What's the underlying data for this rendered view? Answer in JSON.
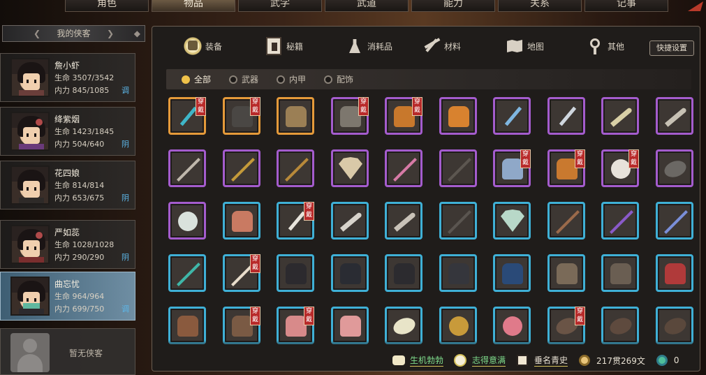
{
  "top_tabs": [
    {
      "label": "角色",
      "active": false
    },
    {
      "label": "物品",
      "active": true
    },
    {
      "label": "武学",
      "active": false
    },
    {
      "label": "武道",
      "active": false
    },
    {
      "label": "能力",
      "active": false
    },
    {
      "label": "关系",
      "active": false
    },
    {
      "label": "记事",
      "active": false
    }
  ],
  "left": {
    "header": "我的侠客",
    "companions": [
      {
        "name": "詹小虾",
        "hp_label": "生命",
        "hp": "3507/3542",
        "mp_label": "内力",
        "mp": "845/1085",
        "tag": "调",
        "selected": false
      },
      {
        "name": "绛紫烟",
        "hp_label": "生命",
        "hp": "1423/1845",
        "mp_label": "内力",
        "mp": "504/640",
        "tag": "阴",
        "selected": false
      },
      {
        "name": "花四娘",
        "hp_label": "生命",
        "hp": "814/814",
        "mp_label": "内力",
        "mp": "653/675",
        "tag": "阴",
        "selected": false
      },
      {
        "name": "严如蕊",
        "hp_label": "生命",
        "hp": "1028/1028",
        "mp_label": "内力",
        "mp": "290/290",
        "tag": "阴",
        "selected": false
      },
      {
        "name": "曲忘忧",
        "hp_label": "生命",
        "hp": "964/964",
        "mp_label": "内力",
        "mp": "699/750",
        "tag": "调",
        "selected": true
      }
    ],
    "empty_label": "暂无侠客"
  },
  "categories": [
    {
      "label": "装备",
      "icon": "equipment-icon",
      "active": true
    },
    {
      "label": "秘籍",
      "icon": "book-icon",
      "active": false
    },
    {
      "label": "消耗品",
      "icon": "flask-icon",
      "active": false
    },
    {
      "label": "材料",
      "icon": "material-icon",
      "active": false
    },
    {
      "label": "地图",
      "icon": "map-icon",
      "active": false
    },
    {
      "label": "其他",
      "icon": "other-icon",
      "active": false
    }
  ],
  "shortcut_button": "快捷设置",
  "filters": [
    {
      "label": "全部",
      "active": true
    },
    {
      "label": "武器",
      "active": false
    },
    {
      "label": "内甲",
      "active": false
    },
    {
      "label": "配饰",
      "active": false
    }
  ],
  "wear_tag": "穿戴",
  "items": [
    [
      {
        "rarity": "orange",
        "kind": "sword",
        "color": "#3fb6c8",
        "worn": true
      },
      {
        "rarity": "orange",
        "kind": "armor",
        "color": "#4a4744",
        "worn": true
      },
      {
        "rarity": "orange",
        "kind": "armor",
        "color": "#9b7f55",
        "worn": false
      },
      {
        "rarity": "purple",
        "kind": "armor",
        "color": "#7d776e",
        "worn": true
      },
      {
        "rarity": "purple",
        "kind": "armor",
        "color": "#c8782c",
        "worn": true
      },
      {
        "rarity": "purple",
        "kind": "armor",
        "color": "#d8822f",
        "worn": false
      },
      {
        "rarity": "purple",
        "kind": "sword",
        "color": "#7fb6e0",
        "worn": false
      },
      {
        "rarity": "purple",
        "kind": "sword",
        "color": "#cfd6de",
        "worn": false
      },
      {
        "rarity": "purple",
        "kind": "blade",
        "color": "#d8cfa6",
        "worn": false
      },
      {
        "rarity": "purple",
        "kind": "blade",
        "color": "#c7c1b4",
        "worn": false
      }
    ],
    [
      {
        "rarity": "purple",
        "kind": "staff",
        "color": "#bfb8ac",
        "worn": false
      },
      {
        "rarity": "purple",
        "kind": "staff",
        "color": "#c49a3a",
        "worn": false
      },
      {
        "rarity": "purple",
        "kind": "staff",
        "color": "#b8893a",
        "worn": false
      },
      {
        "rarity": "purple",
        "kind": "fan",
        "color": "#d9c9a8",
        "worn": false
      },
      {
        "rarity": "purple",
        "kind": "staff",
        "color": "#d67aa6",
        "worn": false
      },
      {
        "rarity": "purple",
        "kind": "staff",
        "color": "#5c5650",
        "worn": false
      },
      {
        "rarity": "purple",
        "kind": "armor",
        "color": "#8fa8c8",
        "worn": true
      },
      {
        "rarity": "purple",
        "kind": "armor",
        "color": "#c9792f",
        "worn": true
      },
      {
        "rarity": "purple",
        "kind": "round",
        "color": "#e7e2da",
        "worn": true
      },
      {
        "rarity": "purple",
        "kind": "leaf",
        "color": "#6b6864",
        "worn": false
      }
    ],
    [
      {
        "rarity": "purple",
        "kind": "round",
        "color": "#d9e2dc",
        "worn": false
      },
      {
        "rarity": "blue",
        "kind": "armor",
        "color": "#c97a62",
        "worn": false
      },
      {
        "rarity": "blue",
        "kind": "sword",
        "color": "#e8e4dc",
        "worn": true
      },
      {
        "rarity": "blue",
        "kind": "blade",
        "color": "#d8d3cb",
        "worn": false
      },
      {
        "rarity": "blue",
        "kind": "blade",
        "color": "#c9c2b8",
        "worn": false
      },
      {
        "rarity": "blue",
        "kind": "staff",
        "color": "#5a5550",
        "worn": false
      },
      {
        "rarity": "blue",
        "kind": "fan",
        "color": "#b8d8c8",
        "worn": false
      },
      {
        "rarity": "blue",
        "kind": "staff",
        "color": "#9a6a4a",
        "worn": false
      },
      {
        "rarity": "blue",
        "kind": "staff",
        "color": "#8a5ac8",
        "worn": false
      },
      {
        "rarity": "blue",
        "kind": "staff",
        "color": "#7a8ed8",
        "worn": false
      }
    ],
    [
      {
        "rarity": "blue",
        "kind": "staff",
        "color": "#3fb6a8",
        "worn": false
      },
      {
        "rarity": "blue",
        "kind": "staff",
        "color": "#e8dccb",
        "worn": true
      },
      {
        "rarity": "blue",
        "kind": "armor",
        "color": "#2c2a2e",
        "worn": false
      },
      {
        "rarity": "blue",
        "kind": "armor",
        "color": "#2a2c33",
        "worn": false
      },
      {
        "rarity": "blue",
        "kind": "armor",
        "color": "#2c2b2f",
        "worn": false
      },
      {
        "rarity": "blue",
        "kind": "armor",
        "color": "#35363c",
        "worn": false
      },
      {
        "rarity": "blue",
        "kind": "armor",
        "color": "#2a4a78",
        "worn": false
      },
      {
        "rarity": "blue",
        "kind": "armor",
        "color": "#7a6a58",
        "worn": false
      },
      {
        "rarity": "blue",
        "kind": "armor",
        "color": "#6a5e52",
        "worn": false
      },
      {
        "rarity": "blue",
        "kind": "armor",
        "color": "#b03a3a",
        "worn": false
      }
    ],
    [
      {
        "rarity": "blue",
        "kind": "armor",
        "color": "#8a5a3e",
        "worn": false
      },
      {
        "rarity": "blue",
        "kind": "armor",
        "color": "#7a5a44",
        "worn": true
      },
      {
        "rarity": "blue",
        "kind": "armor",
        "color": "#d88a8a",
        "worn": true
      },
      {
        "rarity": "blue",
        "kind": "armor",
        "color": "#e09a9a",
        "worn": false
      },
      {
        "rarity": "blue",
        "kind": "leaf",
        "color": "#e8e4c8",
        "worn": false
      },
      {
        "rarity": "blue",
        "kind": "round",
        "color": "#c89a3a",
        "worn": false
      },
      {
        "rarity": "blue",
        "kind": "round",
        "color": "#e07a8a",
        "worn": false
      },
      {
        "rarity": "blue",
        "kind": "leaf",
        "color": "#6a5446",
        "worn": true
      },
      {
        "rarity": "blue",
        "kind": "leaf",
        "color": "#5e4a3e",
        "worn": false
      },
      {
        "rarity": "blue",
        "kind": "leaf",
        "color": "#5a483c",
        "worn": false
      }
    ]
  ],
  "status": [
    {
      "label": "生机勃勃",
      "icon": "vitality-icon",
      "color": "green"
    },
    {
      "label": "志得意满",
      "icon": "mood-icon",
      "color": "green"
    },
    {
      "label": "垂名青史",
      "icon": "fame-icon",
      "color": "white"
    },
    {
      "label": "217贯269文",
      "icon": "coin-icon",
      "color": "white"
    },
    {
      "label": "0",
      "icon": "jade-icon",
      "color": "white"
    }
  ]
}
